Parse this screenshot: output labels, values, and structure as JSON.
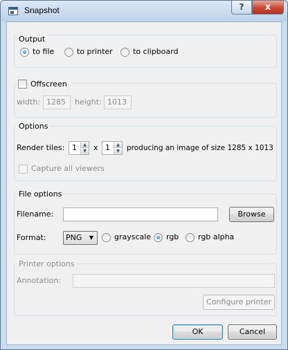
{
  "window": {
    "title": "Snapshot",
    "help_symbol": "?",
    "close_symbol": "x"
  },
  "output": {
    "title": "Output",
    "options": [
      {
        "label": "to file",
        "checked": true
      },
      {
        "label": "to printer",
        "checked": false
      },
      {
        "label": "to clipboard",
        "checked": false
      }
    ]
  },
  "offscreen": {
    "title": "Offscreen",
    "checked": false,
    "width_label": "width:",
    "width_value": "1285",
    "height_label": "height:",
    "height_value": "1013"
  },
  "options": {
    "title": "Options",
    "render_tiles_label": "Render tiles:",
    "tiles_x": "1",
    "times": "x",
    "tiles_y": "1",
    "producing_text": "producing an image of size 1285 x 1013",
    "capture_all_viewers": "Capture all viewers"
  },
  "file_options": {
    "title": "File options",
    "filename_label": "Filename:",
    "filename_value": "",
    "browse": "Browse",
    "format_label": "Format:",
    "format_value": "PNG",
    "color_modes": [
      {
        "label": "grayscale",
        "checked": false
      },
      {
        "label": "rgb",
        "checked": true
      },
      {
        "label": "rgb alpha",
        "checked": false
      }
    ]
  },
  "printer_options": {
    "title": "Printer options",
    "annotation_label": "Annotation:",
    "annotation_value": "",
    "configure": "Configure printer"
  },
  "buttons": {
    "ok": "OK",
    "cancel": "Cancel"
  },
  "icons": {
    "app": "window-app-icon",
    "spin_up": "arrow-up-icon",
    "spin_down": "arrow-down-icon",
    "combo": "chevron-down-icon"
  },
  "colors": {
    "titlebar": "#c9dcef",
    "client": "#f0f0f0",
    "close": "#c94731",
    "accent": "#1e6fc4"
  }
}
